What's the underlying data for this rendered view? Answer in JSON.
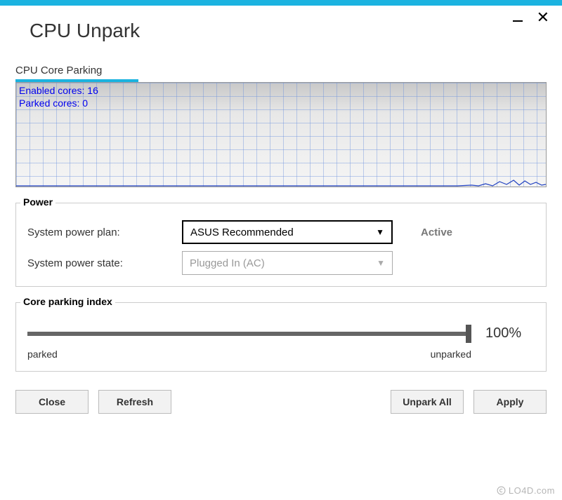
{
  "app": {
    "title": "CPU Unpark"
  },
  "section": {
    "header": "CPU Core Parking"
  },
  "graph": {
    "enabled_label": "Enabled cores:",
    "enabled_value": "16",
    "parked_label": "Parked cores:",
    "parked_value": "  0"
  },
  "power": {
    "group_label": "Power",
    "plan_label": "System power plan:",
    "plan_value": "ASUS Recommended",
    "state_label": "System power state:",
    "state_value": "Plugged In (AC)",
    "status": "Active"
  },
  "core_parking": {
    "group_label": "Core parking index",
    "value": "100%",
    "min_label": "parked",
    "max_label": "unparked"
  },
  "buttons": {
    "close": "Close",
    "refresh": "Refresh",
    "unpark_all": "Unpark All",
    "apply": "Apply"
  },
  "watermark": "LO4D.com"
}
